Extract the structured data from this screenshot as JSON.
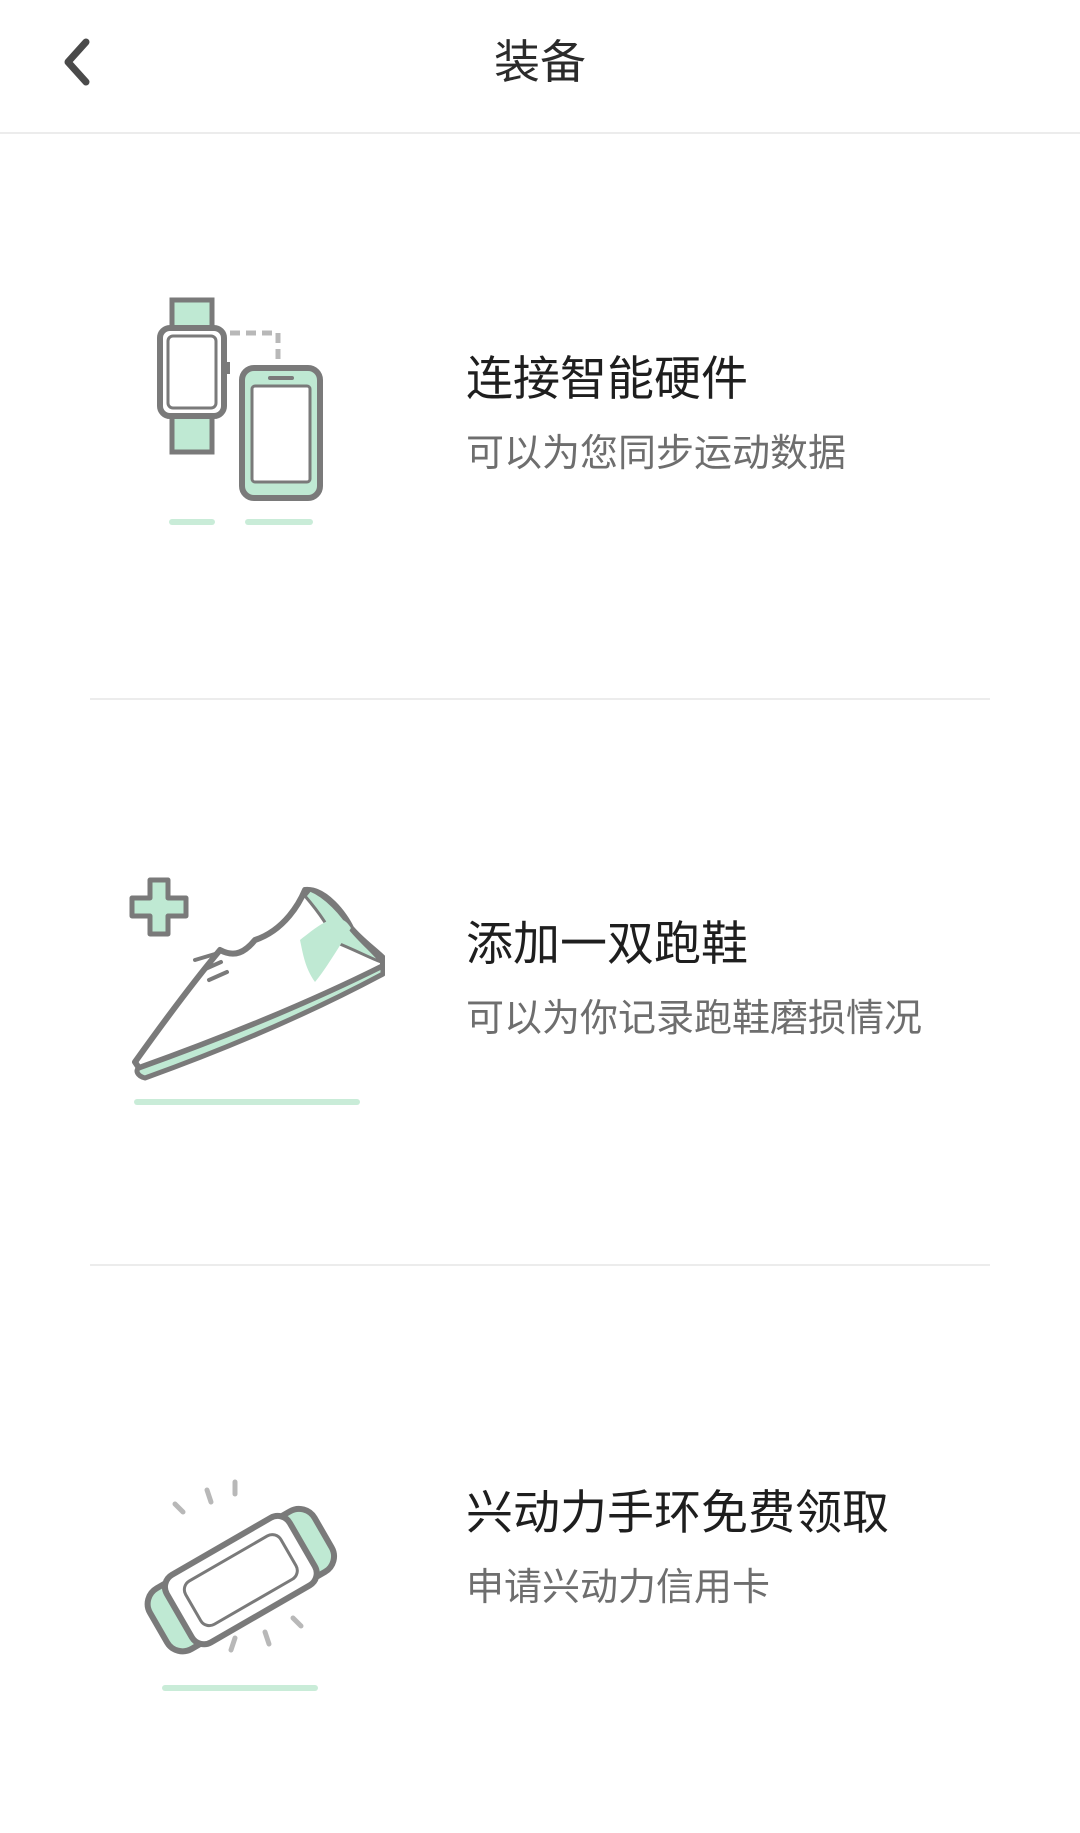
{
  "header": {
    "title": "装备",
    "back_icon": "chevron-left-icon"
  },
  "colors": {
    "accent": "#bfe9d3",
    "outline": "#7a7a7a",
    "divider": "#ececec"
  },
  "items": [
    {
      "title": "连接智能硬件",
      "subtitle": "可以为您同步运动数据",
      "icon": "watch-phone-icon"
    },
    {
      "title": "添加一双跑鞋",
      "subtitle": "可以为你记录跑鞋磨损情况",
      "icon": "running-shoe-icon"
    },
    {
      "title": "兴动力手环免费领取",
      "subtitle": "申请兴动力信用卡",
      "icon": "fitness-band-icon"
    }
  ]
}
